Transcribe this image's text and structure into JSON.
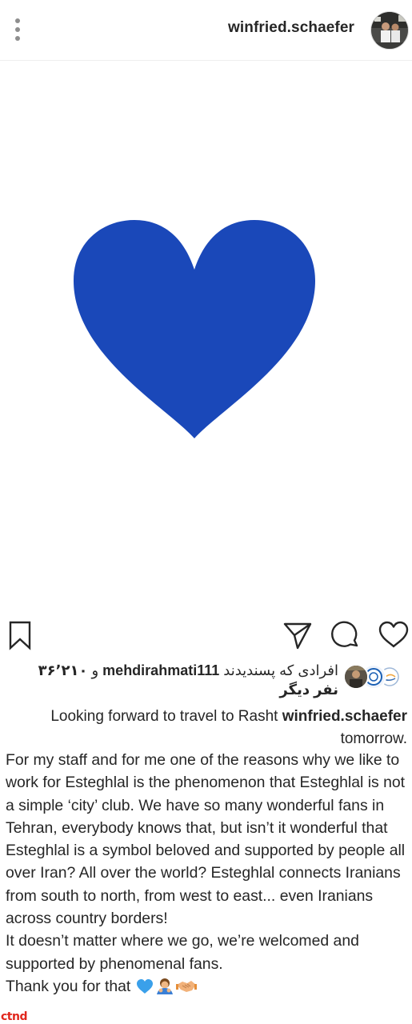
{
  "header": {
    "username": "winfried.schaefer",
    "more_icon": "vertical-dots-icon",
    "avatar_alt": "profile-avatar"
  },
  "post": {
    "image_icon": "blue-heart",
    "heart_color": "#1a48b9"
  },
  "actions": {
    "like_icon": "heart-outline-icon",
    "comment_icon": "comment-bubble-icon",
    "share_icon": "paper-plane-icon",
    "save_icon": "bookmark-icon"
  },
  "likes": {
    "liked_by_prefix": "افرادی که پسندیدند",
    "liked_by_user": "mehdirahmati111",
    "and_word": "و",
    "others_count": "۳۶٬۲۱۰",
    "others_suffix": "نفر دیگر"
  },
  "caption": {
    "author": "winfried.schaefer",
    "headline": "Looking forward to travel to Rasht",
    "headline_end": "tomorrow.",
    "body_line_p1": "For my staff and for me one of the reasons why we like to work for Esteghlal is the phenomenon that Esteghlal is not a simple ‘city’ club. We have so many wonderful fans in Tehran, everybody knows that, but isn’t it wonderful that Esteghlal is a symbol beloved and supported by people all over Iran? All over the world? Esteghlal connects Iranians from south to north, from west to east... even Iranians across country borders!",
    "body_line_p2": "It doesn’t matter where we go, we’re welcomed and supported by phenomenal fans.",
    "body_line_p3": "Thank you for that"
  },
  "watermark": {
    "text": "ctnd"
  },
  "colors": {
    "text": "#262626",
    "divider": "#efefef",
    "watermark": "#e1261c"
  }
}
